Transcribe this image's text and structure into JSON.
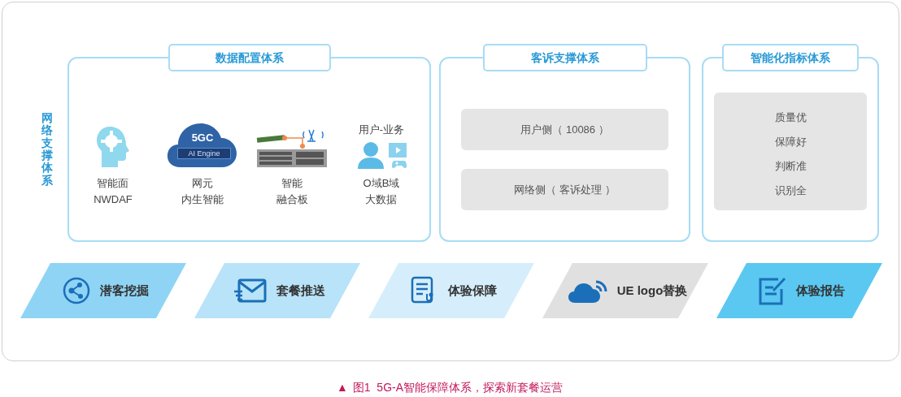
{
  "side_label": "网络支撑体系",
  "panels": [
    {
      "kind": "icons",
      "title": "数据配置体系",
      "items": [
        {
          "lines": [
            "智能面",
            "NWDAF"
          ]
        },
        {
          "lines": [
            "网元",
            "内生智能"
          ],
          "badge_top": "5GC",
          "badge_bottom": "AI Engine"
        },
        {
          "lines": [
            "智能",
            "融合板"
          ]
        },
        {
          "lines": [
            "O域B域",
            "大数据"
          ],
          "caption": "用户-业务"
        }
      ]
    },
    {
      "kind": "boxes",
      "title": "客诉支撑体系",
      "boxes": [
        "用户侧（ 10086 ）",
        "网络侧（ 客诉处理 ）"
      ]
    },
    {
      "kind": "list",
      "title": "智能化指标体系",
      "lines": [
        "质量优",
        "保障好",
        "判断准",
        "识别全"
      ]
    }
  ],
  "steps": [
    {
      "label": "潜客挖掘",
      "color": "#8fd4f5"
    },
    {
      "label": "套餐推送",
      "color": "#b8e3f8"
    },
    {
      "label": "体验保障",
      "color": "#d6eefb"
    },
    {
      "label": "UE logo替换",
      "color": "#e0e0e0"
    },
    {
      "label": "体验报告",
      "color": "#5ac8f1"
    }
  ],
  "caption": {
    "marker": "▲",
    "text": "图1  5G-A智能保障体系，探索新套餐运营"
  }
}
